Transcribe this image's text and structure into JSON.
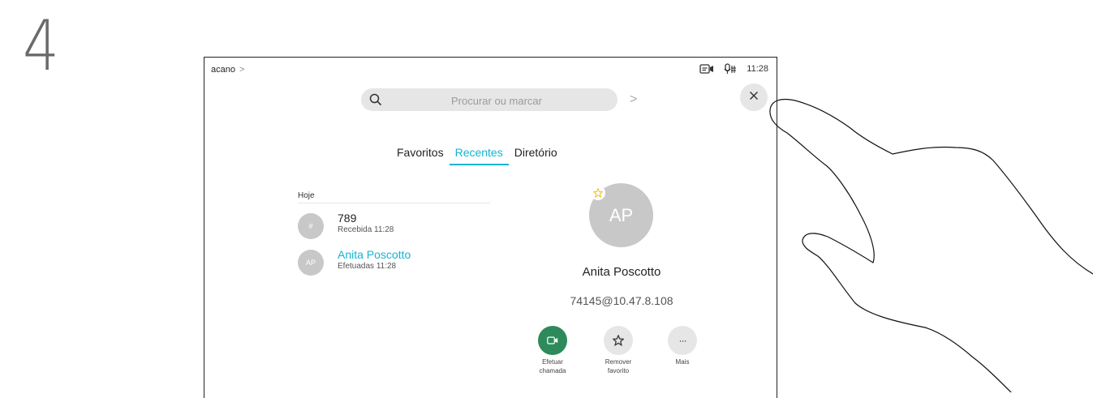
{
  "step_number": "4",
  "status_bar": {
    "system_name": "acano",
    "system_chevron": ">",
    "camera_icon": "camera-status-icon",
    "mic_icon": "mic-mute-icon",
    "time": "11:28"
  },
  "search": {
    "placeholder": "Procurar ou marcar",
    "icon": "search-icon",
    "go_chevron": ">"
  },
  "close_icon": "close-icon",
  "tabs": [
    {
      "label": "Favoritos",
      "active": false
    },
    {
      "label": "Recentes",
      "active": true
    },
    {
      "label": "Diretório",
      "active": false
    }
  ],
  "recents": {
    "section_header": "Hoje",
    "items": [
      {
        "avatar": "#",
        "name": "789",
        "detail": "Recebida 11:28",
        "highlighted": false
      },
      {
        "avatar": "AP",
        "name": "Anita Poscotto",
        "detail": "Efetuadas 11:28",
        "highlighted": true
      }
    ]
  },
  "contact": {
    "initials": "AP",
    "favorite_icon": "star-icon",
    "name": "Anita Poscotto",
    "address": "74145@10.47.8.108"
  },
  "actions": [
    {
      "icon": "video-call-icon",
      "label": "Efetuar\nchamada"
    },
    {
      "icon": "star-icon",
      "label": "Remover\nfavorito"
    },
    {
      "icon": "more-icon",
      "glyph": "···",
      "label": "Mais"
    }
  ],
  "colors": {
    "accent": "#14b5d0",
    "call_green": "#2e8a5b",
    "avatar_grey": "#c8c8c8",
    "favorite_yellow": "#f2c12e"
  }
}
